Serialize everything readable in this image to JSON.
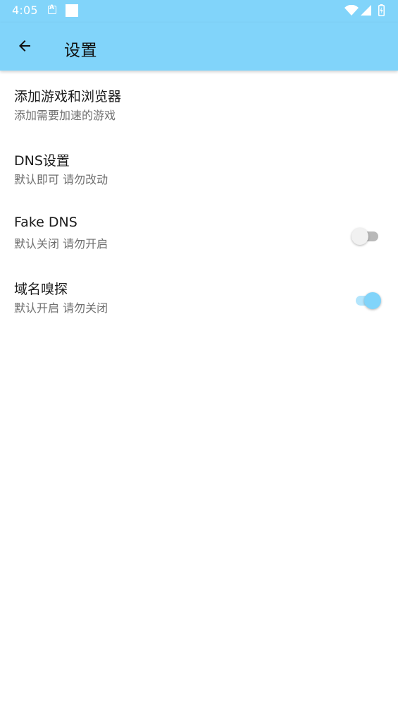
{
  "status_bar": {
    "time": "4:05"
  },
  "app_bar": {
    "title": "设置",
    "back_icon": "arrow-back-icon"
  },
  "colors": {
    "primary": "#81d4fa",
    "primary_light": "#b3e5fc",
    "text_primary": "#1c1c1c",
    "text_secondary": "#6f6f6f"
  },
  "settings": [
    {
      "title": "添加游戏和浏览器",
      "summary": "添加需要加速的游戏"
    },
    {
      "title": "DNS设置",
      "summary": "默认即可 请勿改动"
    },
    {
      "title": "Fake DNS",
      "summary": "默认关闭 请勿开启",
      "switch": "off"
    },
    {
      "title": "域名嗅探",
      "summary": "默认开启 请勿关闭",
      "switch": "on"
    }
  ]
}
